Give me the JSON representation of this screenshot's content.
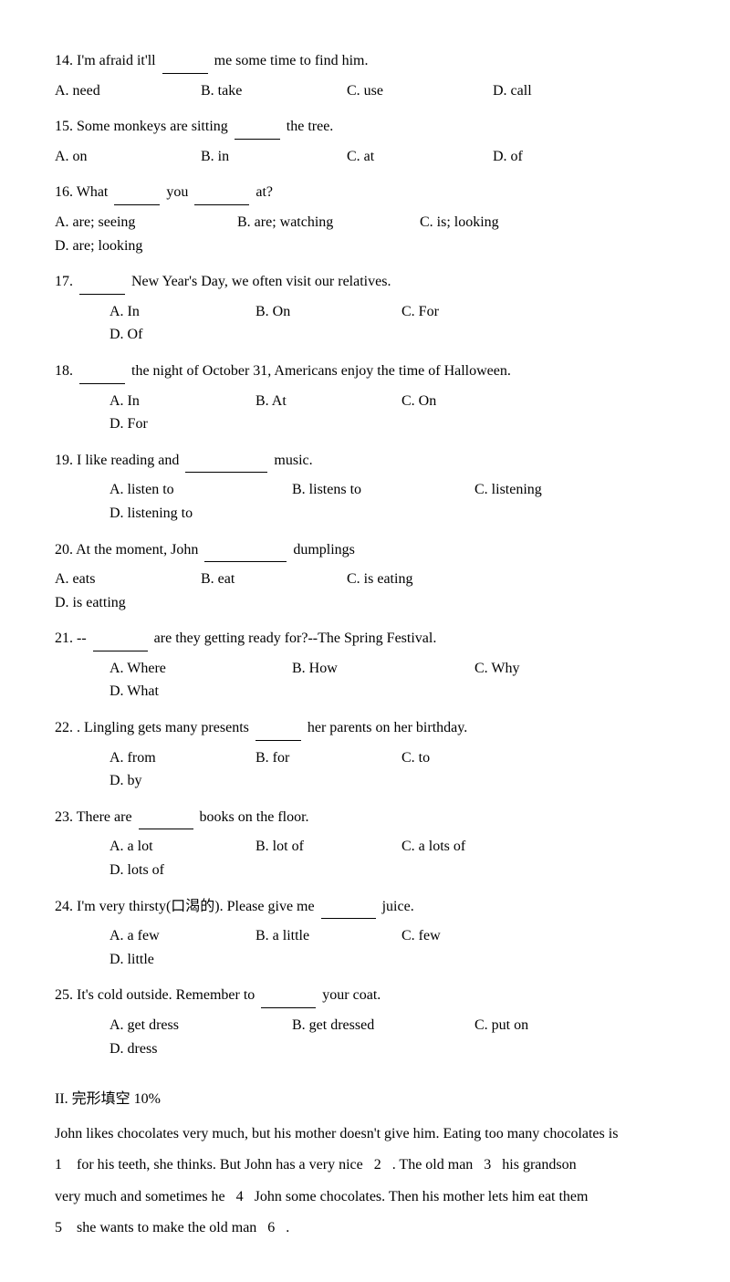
{
  "questions": [
    {
      "id": "q14",
      "text": "14. I'm afraid it'll",
      "blank": "______",
      "rest": "me some time to find him.",
      "options": [
        "A. need",
        "B. take",
        "C. use",
        "D. call"
      ]
    },
    {
      "id": "q15",
      "text": "15. Some monkeys are sitting",
      "blank": "______",
      "rest": "the tree.",
      "options": [
        "A. on",
        "B. in",
        "C. at",
        "D. of"
      ]
    },
    {
      "id": "q16",
      "text": "16. What",
      "blank1": "______",
      "mid": "you",
      "blank2": "________",
      "rest": "at?",
      "options": [
        "A. are; seeing",
        "B. are; watching",
        "C. is; looking",
        "D. are; looking"
      ]
    },
    {
      "id": "q17",
      "text": "17.",
      "blank": "_____",
      "rest": "New Year's Day, we often visit our relatives.",
      "options": [
        "A. In",
        "B. On",
        "C. For",
        "D. Of"
      ]
    },
    {
      "id": "q18",
      "text": "18.",
      "blank": "_____",
      "rest": "the night of October 31, Americans enjoy the time of Halloween.",
      "options": [
        "A. In",
        "B. At",
        "C. On",
        "D. For"
      ]
    },
    {
      "id": "q19",
      "text": "19. I like reading and",
      "blank": "__________",
      "rest": "music.",
      "options": [
        "A. listen to",
        "B. listens to",
        "C. listening",
        "D. listening to"
      ]
    },
    {
      "id": "q20",
      "text": "20. At the moment, John",
      "blank": "__________",
      "rest": "dumplings",
      "options": [
        "A. eats",
        "B. eat",
        "C. is eating",
        "D. is eatting"
      ]
    },
    {
      "id": "q21",
      "text": "21. --",
      "blank": "________",
      "rest": "are they getting ready for?--The Spring Festival.",
      "options": [
        "A. Where",
        "B. How",
        "C. Why",
        "D. What"
      ]
    },
    {
      "id": "q22",
      "text": "22. . Lingling gets many presents",
      "blank": "_____",
      "rest": "her parents on her birthday.",
      "options": [
        "A. from",
        "B. for",
        "C. to",
        "D. by"
      ]
    },
    {
      "id": "q23",
      "text": "23. There are",
      "blank": "________",
      "rest": "books on the floor.",
      "options": [
        "A. a lot",
        "B. lot of",
        "C. a lots of",
        "D. lots of"
      ]
    },
    {
      "id": "q24",
      "text": "24. I'm very thirsty(口渴的). Please give me",
      "blank": "________",
      "rest": "juice.",
      "options": [
        "A. a few",
        "B. a little",
        "C. few",
        "D. little"
      ]
    },
    {
      "id": "q25",
      "text": "25. It's cold outside. Remember to",
      "blank": "________",
      "rest": "your coat.",
      "options": [
        "A. get dress",
        "B. get dressed",
        "C. put on",
        "D. dress"
      ]
    }
  ],
  "section2": {
    "title": "II. 完形填空 10%",
    "passage": "John likes chocolates very much, but his mother doesn't give him. Eating too many chocolates is",
    "lines": [
      {
        "before": "1",
        "text": "for his teeth, she thinks. But John has a very nice",
        "num": "2",
        "rest": ". The old man",
        "num2": "3",
        "rest2": "his grandson"
      },
      {
        "text": "very much and sometimes he",
        "num": "4",
        "rest": "John some chocolates. Then his mother lets him eat them"
      },
      {
        "num": "5",
        "text": "she wants to make the old man",
        "num2": "6",
        "rest": "."
      }
    ]
  }
}
